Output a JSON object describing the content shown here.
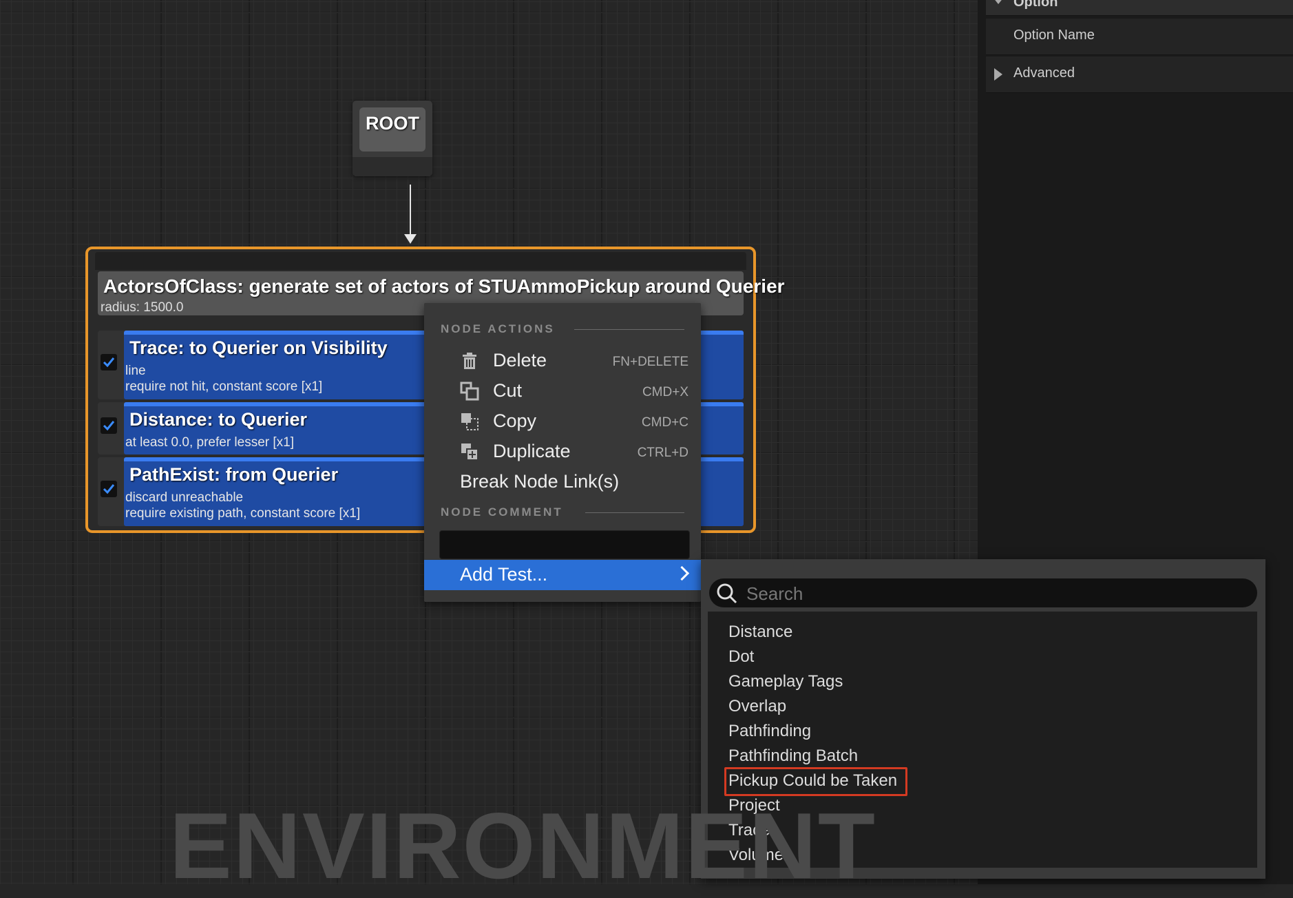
{
  "right_panel": {
    "header": "Option",
    "rows": [
      {
        "label": "Option Name"
      },
      {
        "label": "Advanced"
      }
    ]
  },
  "root_node": {
    "label": "ROOT"
  },
  "generator": {
    "title": "ActorsOfClass: generate set of actors of STUAmmoPickup around Querier",
    "subtitle": "radius: 1500.0",
    "tests": [
      {
        "title": "Trace: to Querier on Visibility",
        "lines": [
          "line",
          "require not hit, constant score [x1]"
        ],
        "checked": true
      },
      {
        "title": "Distance: to Querier",
        "lines": [
          "at least 0.0, prefer lesser [x1]"
        ],
        "checked": true
      },
      {
        "title": "PathExist: from Querier",
        "lines": [
          "discard unreachable",
          "require existing path, constant score [x1]"
        ],
        "checked": true
      }
    ]
  },
  "context_menu": {
    "section_actions": "NODE ACTIONS",
    "items": [
      {
        "label": "Delete",
        "shortcut": "FN+DELETE",
        "icon": "trash-icon"
      },
      {
        "label": "Cut",
        "shortcut": "CMD+X",
        "icon": "cut-icon"
      },
      {
        "label": "Copy",
        "shortcut": "CMD+C",
        "icon": "copy-icon"
      },
      {
        "label": "Duplicate",
        "shortcut": "CTRL+D",
        "icon": "duplicate-icon"
      },
      {
        "label": "Break Node Link(s)",
        "shortcut": "",
        "icon": ""
      }
    ],
    "section_comment": "NODE COMMENT",
    "comment_value": "",
    "add_test": "Add Test..."
  },
  "submenu": {
    "search_placeholder": "Search",
    "items": [
      "Distance",
      "Dot",
      "Gameplay Tags",
      "Overlap",
      "Pathfinding",
      "Pathfinding Batch",
      "Pickup Could be Taken",
      "Project",
      "Trace",
      "Volume"
    ],
    "highlighted": "Pickup Could be Taken",
    "highlight_color": "#d43a22"
  },
  "watermark": "ENVIRONMENT",
  "colors": {
    "node_border": "#e8962a",
    "test_blue": "#1f4ba3",
    "menu_selected": "#2a6fd6"
  }
}
